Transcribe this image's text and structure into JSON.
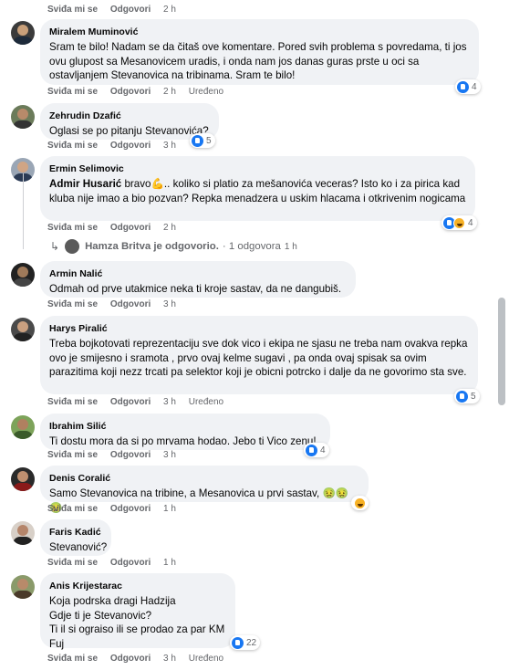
{
  "colors": {
    "bubble": "#f0f2f5",
    "like": "#1877f2",
    "secondary_text": "#65676b"
  },
  "top_actions": {
    "like": "Sviđa mi se",
    "reply": "Odgovori",
    "time": "2 h"
  },
  "comments": [
    {
      "author": "Miralem Muminović",
      "text": "Sram te bilo! Nadam se da čitaš ove komentare. Pored svih problema s povredama, ti jos ovu glupost sa Mesanovicem uradis, i onda nam jos danas guras prste u oci sa ostavljanjem Stevanovica na tribinama. Sram te bilo!",
      "like": "Sviđa mi se",
      "reply": "Odgovori",
      "time": "2 h",
      "edited": "Uređeno",
      "reactions_count": "4",
      "reaction_icons": [
        "like-icon"
      ]
    },
    {
      "author": "Zehrudin Dzafić",
      "text": "Oglasi se po pitanju Stevanovića?",
      "like": "Sviđa mi se",
      "reply": "Odgovori",
      "time": "3 h",
      "reactions_count": "5",
      "reaction_icons": [
        "like-icon"
      ]
    },
    {
      "author": "Ermin Selimovic",
      "mention": "Admir Husarić",
      "text": " bravo💪.. koliko si platio za mešanovića veceras? Isto ko i za pirica kad kluba nije imao a bio pozvan? Repka menadzera u uskim hlacama i otkrivenim nogicama",
      "like": "Sviđa mi se",
      "reply": "Odgovori",
      "time": "2 h",
      "reactions_count": "4",
      "reaction_icons": [
        "like-icon",
        "haha-icon"
      ]
    },
    {
      "author": "Armin Nalić",
      "text": "Odmah od prve utakmice neka ti kroje sastav, da ne dangubiš.",
      "like": "Sviđa mi se",
      "reply": "Odgovori",
      "time": "3 h"
    },
    {
      "author": "Harys Piralić",
      "text": "Treba bojkotovati reprezentaciju sve dok vico i ekipa ne sjasu ne treba nam ovakva repka ovo je smijesno i sramota , prvo ovaj kelme sugavi , pa onda ovaj spisak sa ovim parazitima koji nezz trcati pa selektor koji je obicni potrcko i dalje da ne govorimo sta sve.",
      "like": "Sviđa mi se",
      "reply": "Odgovori",
      "time": "3 h",
      "edited": "Uređeno",
      "reactions_count": "5",
      "reaction_icons": [
        "like-icon"
      ]
    },
    {
      "author": "Ibrahim Silić",
      "text": "Ti dostu mora da si po mrvama hodao. Jebo ti Vico zenu!",
      "like": "Sviđa mi se",
      "reply": "Odgovori",
      "time": "3 h",
      "reactions_count": "4",
      "reaction_icons": [
        "like-icon"
      ]
    },
    {
      "author": "Denis Coralić",
      "text": "Samo Stevanovica na tribine, a Mesanovica u prvi sastav, 🤢🤢🤢",
      "like": "Sviđa mi se",
      "reply": "Odgovori",
      "time": "1 h",
      "reaction_icons": [
        "haha-icon"
      ]
    },
    {
      "author": "Faris Kadić",
      "text": "Stevanović?",
      "like": "Sviđa mi se",
      "reply": "Odgovori",
      "time": "1 h"
    },
    {
      "author": "Anis Krijestarac",
      "lines": [
        "Koja podrska dragi Hadzija",
        "Gdje ti je Stevanovic?",
        "Ti il si ograiso ili se prodao za par KM",
        "Fuj"
      ],
      "like": "Sviđa mi se",
      "reply": "Odgovori",
      "time": "3 h",
      "edited": "Uređeno",
      "reactions_count": "22",
      "reaction_icons": [
        "like-icon"
      ]
    }
  ],
  "reply_summary": {
    "text": "Hamza Britva je odgovorio.",
    "count": "· 1 odgovora",
    "time": "1 h"
  }
}
